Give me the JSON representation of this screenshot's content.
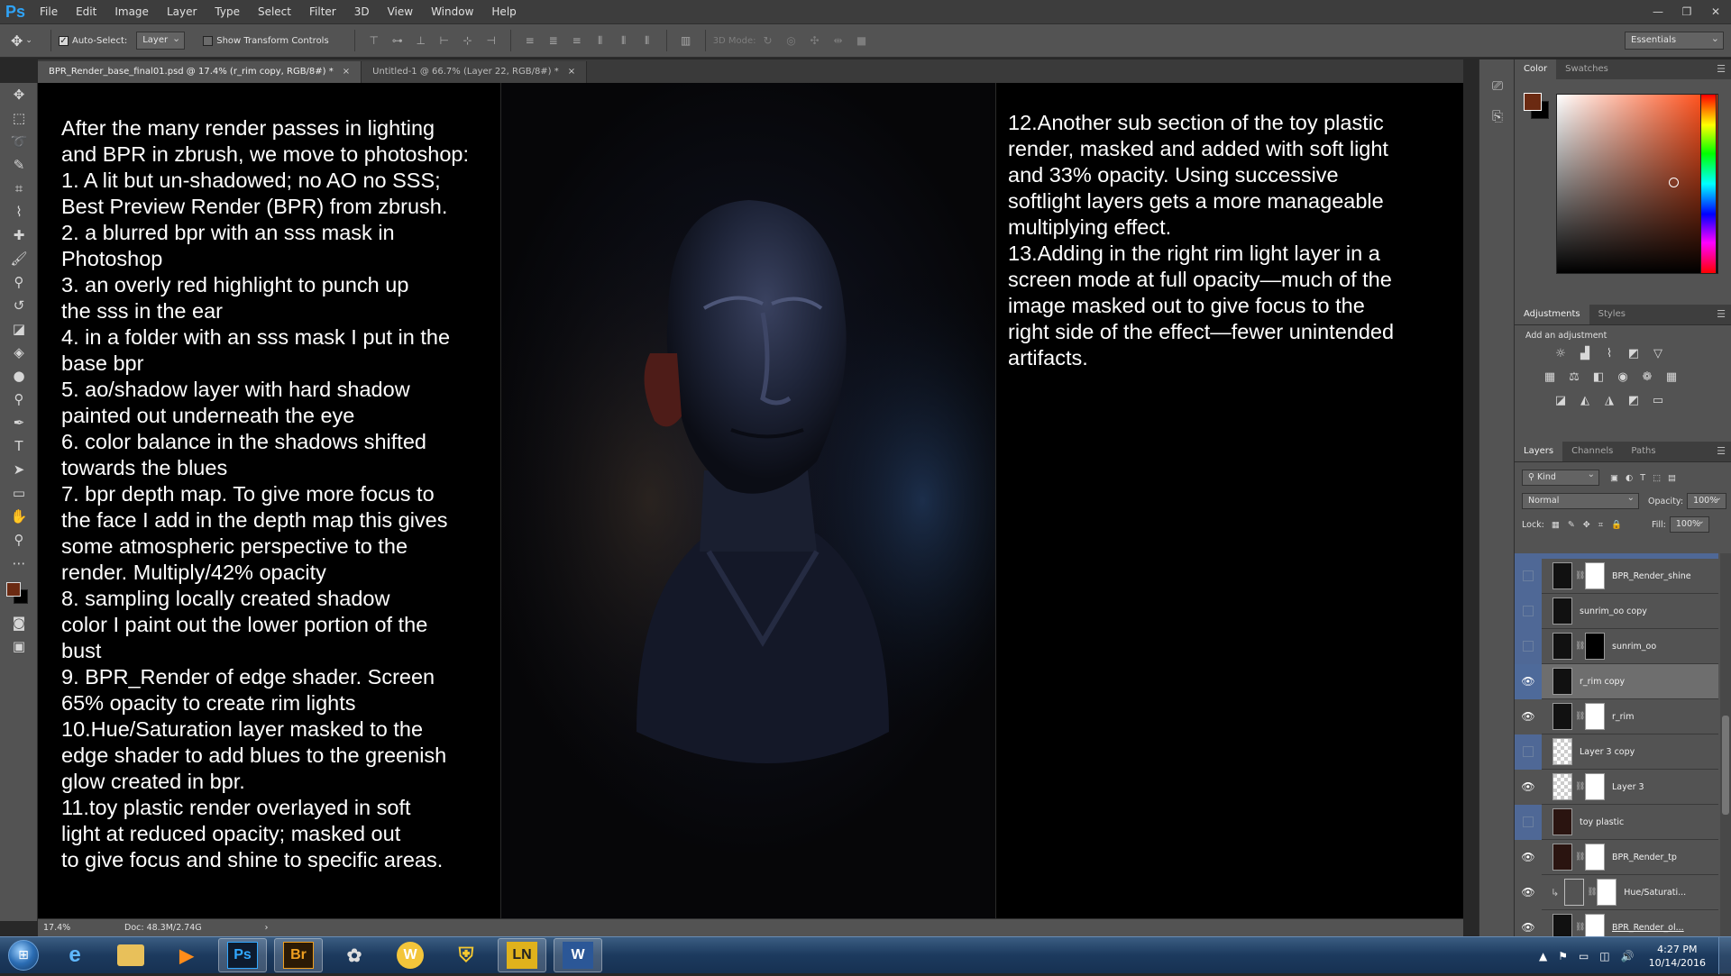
{
  "app": {
    "logo": "Ps"
  },
  "menu": [
    "File",
    "Edit",
    "Image",
    "Layer",
    "Type",
    "Select",
    "Filter",
    "3D",
    "View",
    "Window",
    "Help"
  ],
  "window_controls": {
    "minimize": "—",
    "restore": "❐",
    "close": "✕"
  },
  "options_bar": {
    "auto_select_label": "Auto-Select:",
    "auto_select_checked": true,
    "auto_select_target": "Layer",
    "show_transform_label": "Show Transform Controls",
    "show_transform_checked": false,
    "mode_3d_label": "3D Mode:",
    "workspace": "Essentials"
  },
  "tabs": [
    {
      "label": "BPR_Render_base_final01.psd @ 17.4% (r_rim copy, RGB/8#) *",
      "active": true,
      "close": "×"
    },
    {
      "label": "Untitled-1 @ 66.7% (Layer 22, RGB/8#) *",
      "active": false,
      "close": "×"
    }
  ],
  "canvas": {
    "left_text": "After the many render passes in lighting\nand BPR in zbrush, we move to photoshop:\n1.  A lit but un-shadowed; no AO no SSS;\nBest Preview Render (BPR) from zbrush.\n2.  a blurred bpr with an sss mask in\nPhotoshop\n3.  an overly red highlight to punch up\nthe sss in the ear\n4.  in a folder with an sss mask I put in the\nbase bpr\n5.  ao/shadow layer with hard shadow\npainted out underneath the eye\n6.  color balance in the shadows shifted\ntowards the blues\n7.  bpr depth map.  To give more focus to\nthe face I add in the depth map this gives\nsome atmospheric perspective to the\nrender. Multiply/42% opacity\n8.  sampling locally created shadow\ncolor I paint out the lower portion of the\nbust\n9.  BPR_Render of edge shader.  Screen\n65% opacity  to create rim lights\n10.Hue/Saturation layer masked to the\nedge shader to add blues to the greenish\nglow created in bpr.\n11.toy plastic render overlayed in soft\nlight at reduced opacity; masked out\nto give focus and shine to specific areas.",
    "right_text": "12.Another sub section of the toy plastic\nrender, masked and added with soft light\nand 33% opacity.  Using successive\nsoftlight layers gets a more manageable\nmultiplying effect.\n13.Adding in the right rim light layer in a\nscreen mode at full opacity—much of the\nimage masked out to give focus to the\nright side of the effect—fewer unintended\nartifacts."
  },
  "status": {
    "zoom": "17.4%",
    "doc": "Doc: 48.3M/2.74G",
    "arrow": "›"
  },
  "color_panel": {
    "tabs": [
      "Color",
      "Swatches"
    ],
    "fg": "#6b2a12",
    "bg": "#000000"
  },
  "adjustments_panel": {
    "tabs": [
      "Adjustments",
      "Styles"
    ],
    "title": "Add an adjustment"
  },
  "layers_panel": {
    "tabs": [
      "Layers",
      "Channels",
      "Paths"
    ],
    "filter_kind": "Kind",
    "blend_mode": "Normal",
    "opacity_label": "Opacity:",
    "opacity_value": "100%",
    "lock_label": "Lock:",
    "fill_label": "Fill:",
    "fill_value": "100%",
    "layers": [
      {
        "name": "BPR_Render_shine",
        "visible": false,
        "has_mask": true,
        "selected": false
      },
      {
        "name": "sunrim_oo copy",
        "visible": false,
        "has_mask": false,
        "selected": false
      },
      {
        "name": "sunrim_oo",
        "visible": false,
        "has_mask": true,
        "selected": false
      },
      {
        "name": "r_rim copy",
        "visible": true,
        "has_mask": false,
        "selected": true
      },
      {
        "name": "r_rim",
        "visible": true,
        "has_mask": true,
        "selected": false
      },
      {
        "name": "Layer 3 copy",
        "visible": false,
        "has_mask": false,
        "selected": false
      },
      {
        "name": "Layer 3",
        "visible": true,
        "has_mask": true,
        "selected": false
      },
      {
        "name": "toy plastic",
        "visible": false,
        "has_mask": false,
        "selected": false
      },
      {
        "name": "BPR_Render_tp",
        "visible": true,
        "has_mask": true,
        "selected": false
      },
      {
        "name": "Hue/Saturati...",
        "visible": true,
        "has_mask": true,
        "selected": false
      },
      {
        "name": "BPR_Render_ol...",
        "visible": true,
        "has_mask": true,
        "selected": false
      }
    ]
  },
  "taskbar": {
    "apps": [
      "IE",
      "Explorer",
      "Media",
      "Ps",
      "Br",
      "Paint",
      "W",
      "Security",
      "LN",
      "Word"
    ],
    "clock_time": "4:27 PM",
    "clock_date": "10/14/2016"
  }
}
